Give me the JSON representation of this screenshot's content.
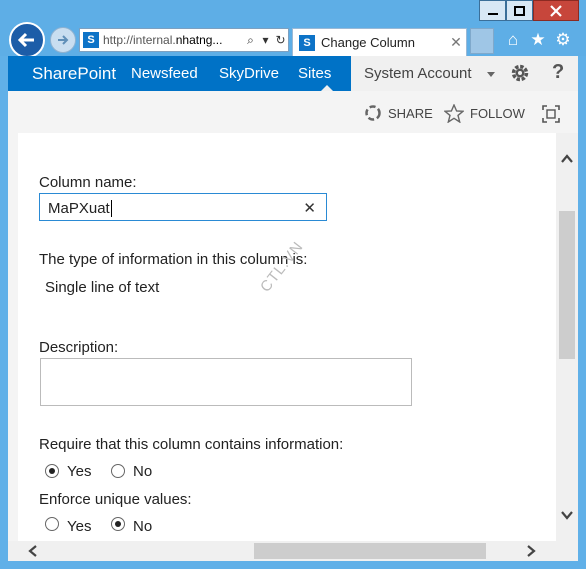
{
  "browser": {
    "address_prefix": "http://internal.",
    "address_domain": "nhatng...",
    "tab_title": "Change Column",
    "favicon_letter": "S"
  },
  "suitebar": {
    "brand": "SharePoint",
    "links": [
      "Newsfeed",
      "SkyDrive",
      "Sites"
    ],
    "active_link": "Sites",
    "account": "System Account",
    "accent": "#0072c6"
  },
  "page_actions": {
    "share": "SHARE",
    "follow": "FOLLOW"
  },
  "form": {
    "column_name_label": "Column name:",
    "column_name_value": "MaPXuat",
    "type_label": "The type of information in this column is:",
    "type_value": "Single line of text",
    "description_label": "Description:",
    "description_value": "",
    "required_label": "Require that this column contains information:",
    "required_options": [
      {
        "label": "Yes",
        "selected": true
      },
      {
        "label": "No",
        "selected": false
      }
    ],
    "unique_label": "Enforce unique values:",
    "unique_options": [
      {
        "label": "Yes",
        "selected": false
      },
      {
        "label": "No",
        "selected": true
      }
    ]
  },
  "watermark": "CTL.VN",
  "icons": [
    "back-arrow-icon",
    "forward-arrow-icon",
    "search-icon",
    "refresh-icon",
    "close-icon",
    "home-icon",
    "favorites-star-icon",
    "settings-gear-icon",
    "share-icon",
    "follow-star-icon",
    "focus-icon",
    "help-icon"
  ]
}
